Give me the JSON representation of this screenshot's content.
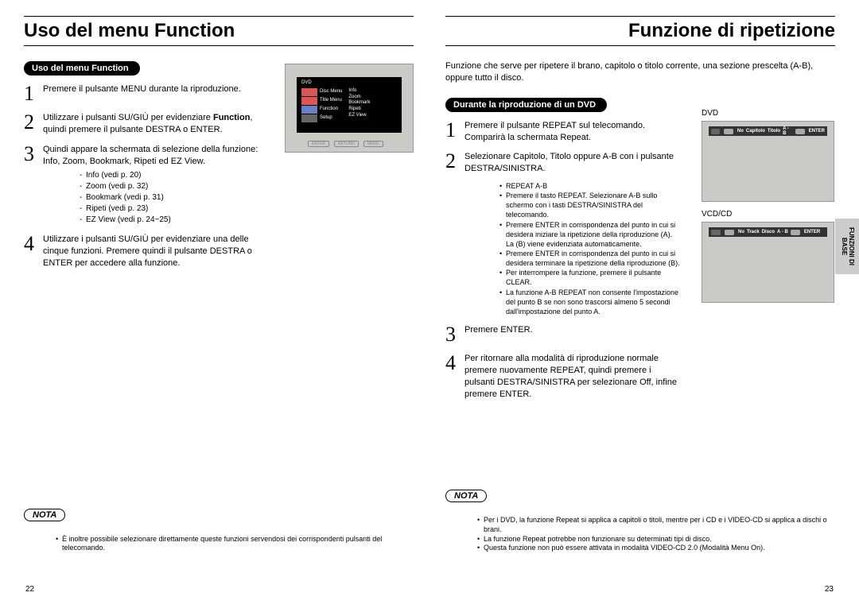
{
  "left": {
    "title": "Uso del menu Function",
    "section_pill": "Uso del menu Function",
    "steps": [
      "Premere il pulsante MENU durante la riproduzione.",
      "Utilizzare i pulsanti SU/GIÙ per evidenziare <b>Function</b>, quindi premere il pulsante DESTRA o ENTER.",
      "Quindi appare la schermata di selezione della funzione: Info, Zoom, Bookmark, Ripeti ed EZ View.",
      "Utilizzare i pulsanti SU/GIÙ per evidenziare una delle cinque funzioni. Premere quindi il pulsante DESTRA o ENTER per accedere alla funzione."
    ],
    "sub_items": [
      "Info (vedi p. 20)",
      "Zoom (vedi p. 32)",
      "Bookmark (vedi p. 31)",
      "Ripeti (vedi p. 23)",
      "EZ View (vedi p. 24~25)"
    ],
    "screen": {
      "dvd": "DVD",
      "menu_left": [
        "Disc Menu",
        "Title Menu",
        "Function",
        "Setup"
      ],
      "menu_right": [
        "Info",
        "Zoom",
        "Bookmark",
        "Ripeti",
        "EZ View"
      ],
      "buttons": [
        "ENTER",
        "RETURN",
        "MENU"
      ]
    },
    "nota_label": "NOTA",
    "nota": [
      "È inoltre possibile selezionare direttamente queste funzioni servendosi dei corrispondenti pulsanti del telecomando."
    ],
    "pagenum": "22"
  },
  "right": {
    "title": "Funzione di ripetizione",
    "intro": "Funzione che serve per ripetere il brano, capitolo o titolo corrente, una sezione prescelta (A-B), oppure tutto il disco.",
    "section_pill": "Durante la riproduzione di un DVD",
    "steps": [
      "Premere il pulsante REPEAT sul telecomando. Comparirà la schermata Repeat.",
      "Selezionare Capitolo, Titolo oppure A-B con i pulsante DESTRA/SINISTRA.",
      "Premere ENTER.",
      "Per ritornare alla modalità di riproduzione normale premere nuovamente REPEAT, quindi premere i pulsanti DESTRA/SINISTRA per selezionare Off, infine premere ENTER."
    ],
    "sub_title": "REPEAT A-B",
    "sub_items": [
      "Premere il tasto REPEAT. Selezionare A-B sullo schermo con i tasti DESTRA/SINISTRA del telecomando.",
      "Premere ENTER in corrispondenza del punto in cui si desidera iniziare la ripetizione della riproduzione (A). La (B) viene evidenziata automaticamente.",
      "Premere ENTER in corrispondenza del punto in cui si desidera terminare la ripetizione della riproduzione (B).",
      "Per interrompere la funzione, premere il pulsante CLEAR.",
      "La funzione A-B REPEAT non consente l'impostazione del punto B se non sono trascorsi almeno 5 secondi dall'impostazione del punto A."
    ],
    "screens": {
      "dvd_label": "DVD",
      "dvd_bar": [
        "No",
        "Capitolo",
        "Titolo",
        "A - B",
        "ENTER"
      ],
      "vcd_label": "VCD/CD",
      "vcd_bar": [
        "No",
        "Track",
        "Disco",
        "A - B",
        "ENTER"
      ]
    },
    "nota_label": "NOTA",
    "nota": [
      "Per i DVD, la funzione Repeat si applica a capitoli o titoli, mentre per i CD e i VIDEO-CD si applica a dischi o brani.",
      "La funzione Repeat potrebbe non funzionare su determinati tipi di disco.",
      "Questa funzione non può essere attivata in modalità VIDEO-CD 2.0 (Modalità Menu On)."
    ],
    "sidetab": "FUNZIONI DI BASE",
    "pagenum": "23"
  }
}
